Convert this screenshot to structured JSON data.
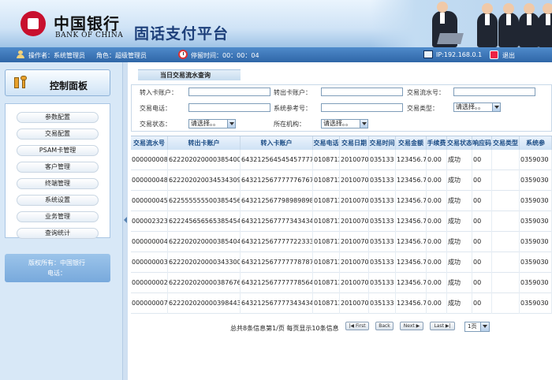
{
  "header": {
    "logo_cn": "中国银行",
    "logo_en": "BANK OF CHINA",
    "platform_title": "固话支付平台"
  },
  "status_bar": {
    "operator": "操作者：系统管理员",
    "role": "角色：超级管理员",
    "stay_time": "停留时间：00：00：04",
    "ip": "IP:192.168.0.1",
    "logout": "退出"
  },
  "sidebar": {
    "title": "控制面板",
    "menu": [
      "参数配置",
      "交易配置",
      "PSAM卡管理",
      "客户管理",
      "终端管理",
      "系统设置",
      "业务管理",
      "查询统计"
    ],
    "copyright": "版权所有：中国银行",
    "phone": "电话："
  },
  "query": {
    "tab_title": "当日交易流水查询",
    "labels": {
      "in_account": "转入卡账户：",
      "out_account": "转出卡账户：",
      "serial_no": "交易流水号：",
      "phone": "交易电话：",
      "ref_no": "系统参考号：",
      "txn_type": "交易类型：",
      "txn_status": "交易状态：",
      "org": "所在机构："
    },
    "select_placeholder": "请选择。。"
  },
  "table": {
    "headers": [
      "交易流水号",
      "转出卡账户",
      "转入卡账户",
      "交易电话",
      "交易日期",
      "交易时间",
      "交易金额",
      "手续费",
      "交易状态",
      "响应码",
      "交易类型",
      "系统参"
    ],
    "rows": [
      [
        "0000000088",
        "6222020200003854003",
        "6432125645454577777",
        "0108713",
        "20100705",
        "035133",
        "123456.78",
        "0.00",
        "成功",
        "00",
        "",
        "0359030"
      ],
      [
        "0000000488",
        "6222020200345343098",
        "6432125677777767674",
        "0108713",
        "20100705",
        "035133",
        "123456.78",
        "0.00",
        "成功",
        "00",
        "",
        "0359030"
      ],
      [
        "0000000454",
        "6225555555003854564",
        "6432125677989898989",
        "0108713",
        "20100705",
        "035133",
        "123456.78",
        "0.00",
        "成功",
        "00",
        "",
        "0359030"
      ],
      [
        "0000023232",
        "6222456565653854543",
        "6432125677773434343434",
        "0108713",
        "20100705",
        "035133",
        "123456.78",
        "0.00",
        "成功",
        "00",
        "",
        "0359030"
      ],
      [
        "0000000045",
        "6222020200003854043",
        "6432125677777223332",
        "0108713",
        "20100705",
        "035133",
        "123456.78",
        "0.00",
        "成功",
        "00",
        "",
        "0359030"
      ],
      [
        "0000000034",
        "6222020200003433003",
        "6432125677777787878787",
        "0108713",
        "20100705",
        "035133",
        "123456.78",
        "0.00",
        "成功",
        "00",
        "",
        "0359030"
      ],
      [
        "0000000023",
        "6222020200003876767",
        "6432125677777785645",
        "0108713",
        "20100705",
        "035133",
        "123456.78",
        "0.00",
        "成功",
        "00",
        "",
        "0359030"
      ],
      [
        "0000000078",
        "6222020200003984435",
        "6432125677773434343433",
        "0108713",
        "20100705",
        "035133",
        "123456.78",
        "0.00",
        "成功",
        "00",
        "",
        "0359030"
      ]
    ]
  },
  "pager": {
    "info": "总共8条信息第1/页 每页显示10条信息",
    "first": "|◀ First",
    "back": "Back",
    "next": "Next ▶",
    "last": "Last ▶|",
    "page_select": "1页"
  },
  "colors": {
    "brand_red": "#c8102e",
    "status_bar": "#3a74b8",
    "header_text": "#1c4d86"
  }
}
